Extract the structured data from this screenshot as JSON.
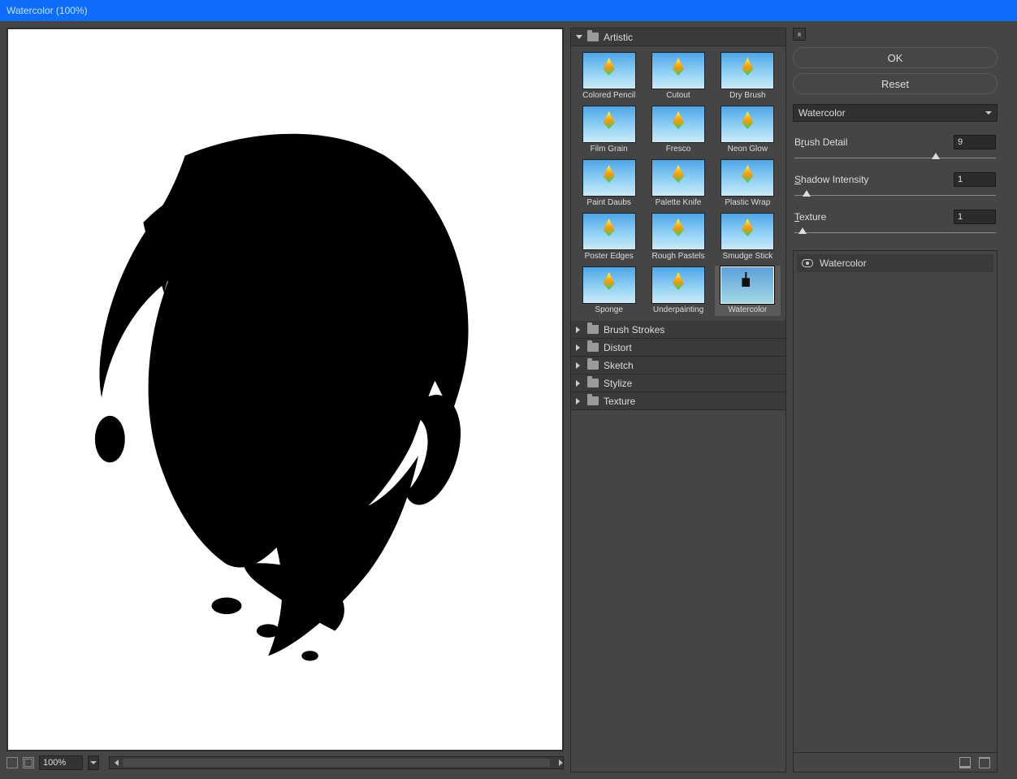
{
  "title": "Watercolor (100%)",
  "zoom": "100%",
  "categories": {
    "open": "Artistic",
    "thumbs": [
      {
        "label": "Colored Pencil"
      },
      {
        "label": "Cutout"
      },
      {
        "label": "Dry Brush"
      },
      {
        "label": "Film Grain"
      },
      {
        "label": "Fresco"
      },
      {
        "label": "Neon Glow"
      },
      {
        "label": "Paint Daubs"
      },
      {
        "label": "Palette Knife"
      },
      {
        "label": "Plastic Wrap"
      },
      {
        "label": "Poster Edges"
      },
      {
        "label": "Rough Pastels"
      },
      {
        "label": "Smudge Stick"
      },
      {
        "label": "Sponge"
      },
      {
        "label": "Underpainting"
      },
      {
        "label": "Watercolor",
        "selected": true
      }
    ],
    "closed": [
      "Brush Strokes",
      "Distort",
      "Sketch",
      "Stylize",
      "Texture"
    ]
  },
  "buttons": {
    "ok": "OK",
    "reset": "Reset"
  },
  "filter_select": "Watercolor",
  "params": [
    {
      "label_pre": "B",
      "label_u": "r",
      "label_post": "ush Detail",
      "value": "9",
      "pos": 70
    },
    {
      "label_pre": "",
      "label_u": "S",
      "label_post": "hadow Intensity",
      "value": "1",
      "pos": 6
    },
    {
      "label_pre": "",
      "label_u": "T",
      "label_post": "exture",
      "value": "1",
      "pos": 4
    }
  ],
  "layer": "Watercolor"
}
